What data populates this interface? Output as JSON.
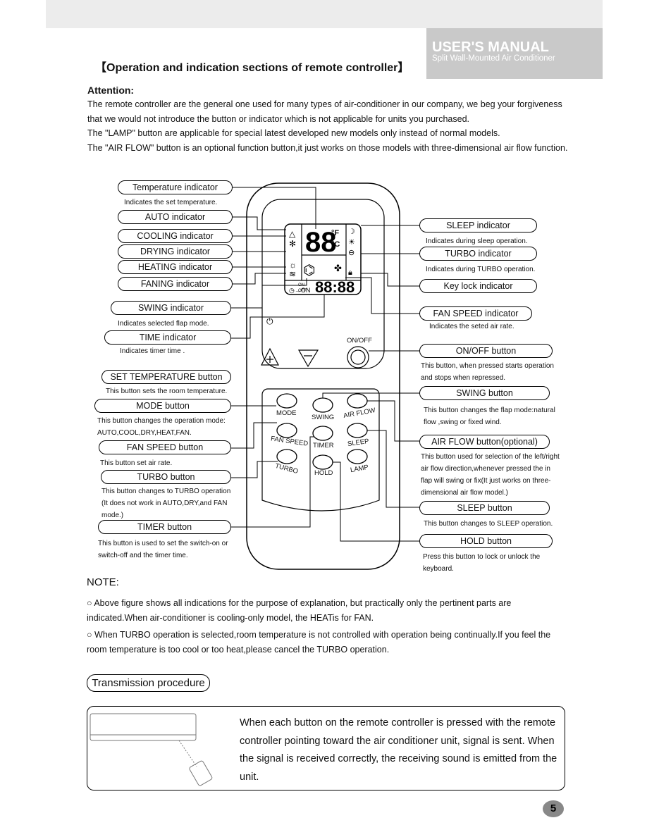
{
  "header": {
    "manual_title": "USER'S MANUAL",
    "subtitle": "Split Wall-Mounted Air Conditioner"
  },
  "section_title": "【Operation and indication sections of remote controller】",
  "attention": {
    "heading": "Attention:",
    "lines": [
      "The remote controller are the general one used for many types of air-conditioner in our company, we beg  your forgiveness",
      "that we would not introduce the button or indicator which is not applicable for units you purchased.",
      "The \"LAMP\" button are applicable for special latest developed new models only instead of normal models.",
      "The \"AIR FLOW\" button is an optional function button,it just works on those models with three-dimensional air flow function."
    ]
  },
  "left_labels": [
    {
      "label": "Temperature indicator",
      "caption": [
        "Indicates the set temperature."
      ]
    },
    {
      "label": "AUTO indicator",
      "caption": []
    },
    {
      "label": "COOLING indicator",
      "caption": []
    },
    {
      "label": "DRYING indicator",
      "caption": []
    },
    {
      "label": "HEATING indicator",
      "caption": []
    },
    {
      "label": "FANING indicator",
      "caption": []
    },
    {
      "label": "SWING indicator",
      "caption": [
        "Indicates selected flap mode."
      ]
    },
    {
      "label": "TIME indicator",
      "caption": [
        "Indicates timer time ."
      ]
    },
    {
      "label": "SET TEMPERATURE button",
      "caption": [
        "This button sets the room temperature."
      ]
    },
    {
      "label": "MODE button",
      "caption": [
        "This button changes  the operation mode:",
        "AUTO,COOL,DRY,HEAT,FAN."
      ]
    },
    {
      "label": "FAN SPEED  button",
      "caption": [
        "This button set air rate."
      ]
    },
    {
      "label": "TURBO  button",
      "caption": [
        "This button changes to TURBO operation",
        "(It does not work in AUTO,DRY,and FAN",
        "mode.)"
      ]
    },
    {
      "label": "TIMER  button",
      "caption": [
        "This button is used to set the switch-on or",
        "switch-off and the timer time."
      ]
    }
  ],
  "right_labels": [
    {
      "label": "SLEEP indicator",
      "caption": [
        "Indicates during sleep operation."
      ]
    },
    {
      "label": "TURBO indicator",
      "caption": [
        "Indicates during TURBO operation."
      ]
    },
    {
      "label": "Key lock  indicator",
      "caption": []
    },
    {
      "label": "FAN SPEED  indicator",
      "caption": [
        "Indicates the seted air rate."
      ]
    },
    {
      "label": "ON/OFF button",
      "caption": [
        "This button, when pressed starts operation",
        "and stops when repressed."
      ]
    },
    {
      "label": "SWING button",
      "caption": [
        "This button changes the flap mode:natural",
        "flow  ,swing or fixed wind."
      ]
    },
    {
      "label": "AIR FLOW  button(optional)",
      "caption": [
        "This button used for selection of the left/right",
        "air flow direction,whenever pressed the in",
        "flap will swing or fix(It just works on three-",
        "dimensional air flow model.)"
      ]
    },
    {
      "label": "SLEEP button",
      "caption": [
        "This button changes to SLEEP operation."
      ]
    },
    {
      "label": "HOLD button",
      "caption": [
        "Press this button to lock or unlock the",
        "keyboard."
      ]
    }
  ],
  "remote": {
    "lcd_temp": "88",
    "unit_f": "°F",
    "unit_c": "°C",
    "timer_on": "ON",
    "timer_off": "OFF",
    "lcd_time": "88:88",
    "onoff": "ON/OFF",
    "buttons": [
      "MODE",
      "SWING",
      "AIR FLOW",
      "FAN SPEED",
      "TIMER",
      "SLEEP",
      "TURBO",
      "HOLD",
      "LAMP"
    ]
  },
  "note": {
    "heading": "NOTE:",
    "items": [
      "Above figure shows all indications for the purpose of explanation, but practically only the pertinent parts are indicated.When air-conditioner is cooling-only model, the HEATis for FAN.",
      "When TURBO operation is selected,room temperature is not controlled with operation being continually.If you feel the room temperature is too cool or too heat,please cancel the TURBO operation."
    ]
  },
  "transmission": {
    "heading": "Transmission procedure",
    "text": "When each button on the remote controller is pressed with the remote controller pointing toward the air conditioner unit, signal is sent. When the signal is received correctly, the receiving sound is emitted from the unit."
  },
  "page_number": "5"
}
